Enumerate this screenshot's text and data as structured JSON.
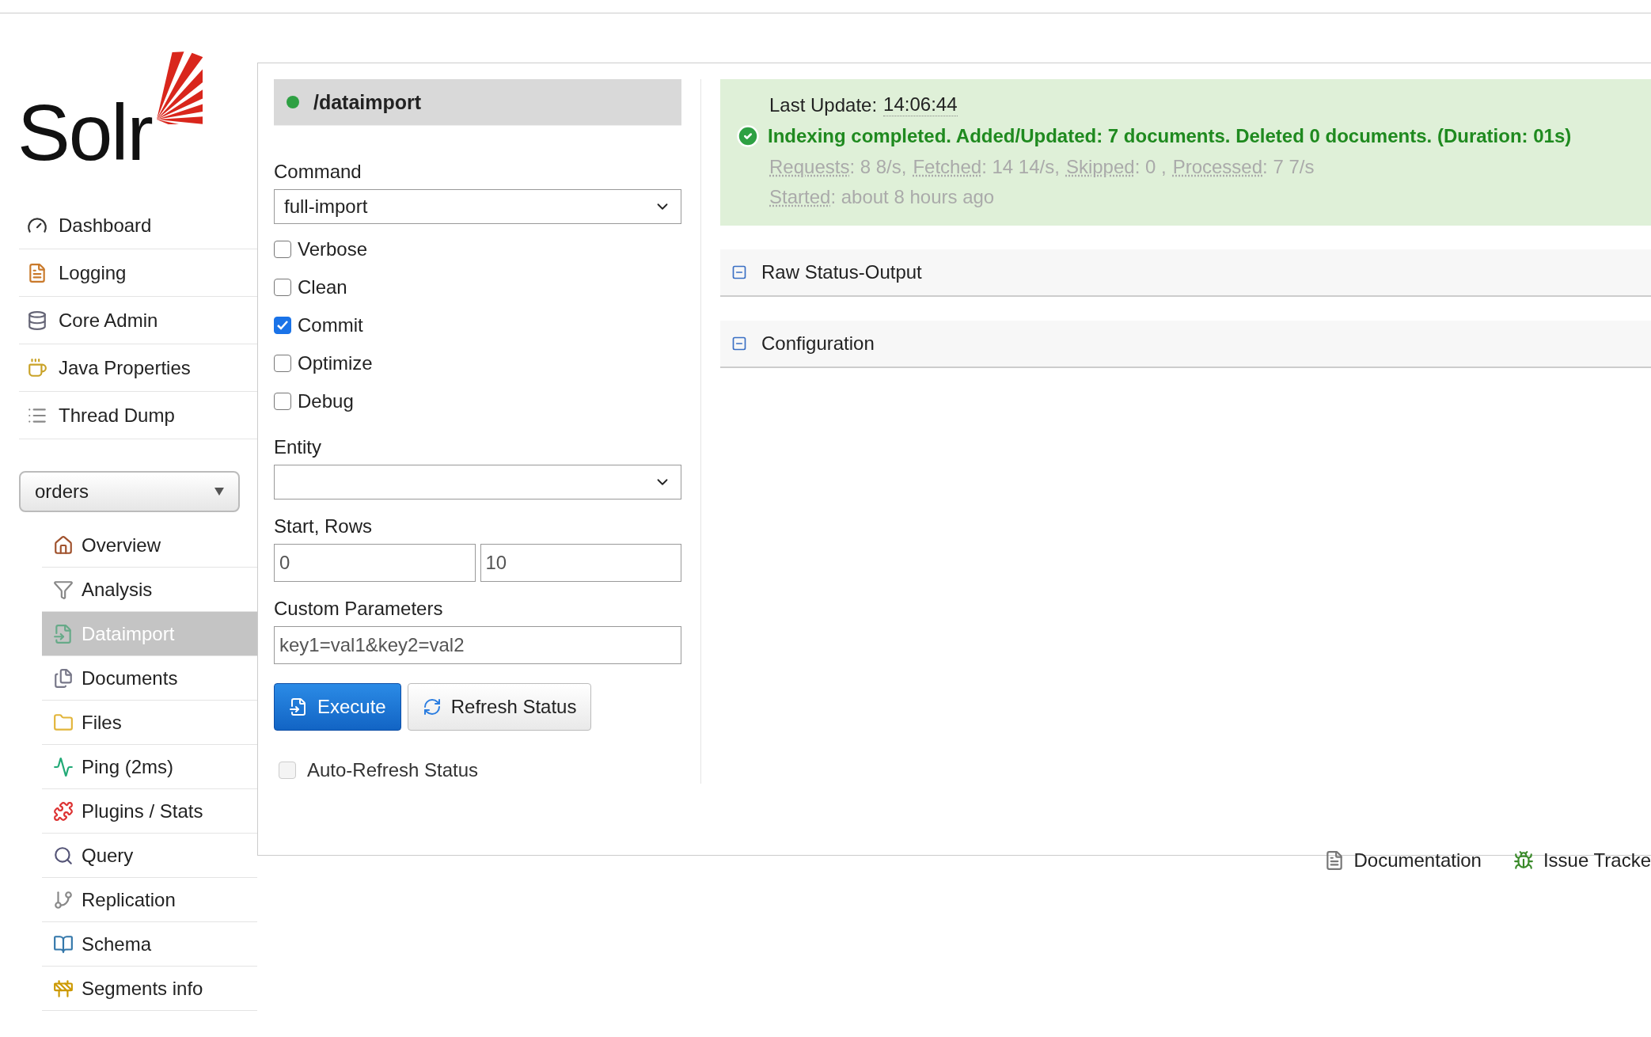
{
  "logo": {
    "text": "Solr"
  },
  "nav": [
    {
      "label": "Dashboard"
    },
    {
      "label": "Logging"
    },
    {
      "label": "Core Admin"
    },
    {
      "label": "Java Properties"
    },
    {
      "label": "Thread Dump"
    }
  ],
  "core_selector": {
    "value": "orders"
  },
  "core_menu": [
    {
      "label": "Overview",
      "selected": false
    },
    {
      "label": "Analysis",
      "selected": false
    },
    {
      "label": "Dataimport",
      "selected": true
    },
    {
      "label": "Documents",
      "selected": false
    },
    {
      "label": "Files",
      "selected": false
    },
    {
      "label": "Ping (2ms)",
      "selected": false
    },
    {
      "label": "Plugins / Stats",
      "selected": false
    },
    {
      "label": "Query",
      "selected": false
    },
    {
      "label": "Replication",
      "selected": false
    },
    {
      "label": "Schema",
      "selected": false
    },
    {
      "label": "Segments info",
      "selected": false
    }
  ],
  "handler": {
    "title": "/dataimport"
  },
  "form": {
    "command_label": "Command",
    "command_value": "full-import",
    "options": [
      {
        "label": "Verbose",
        "checked": false
      },
      {
        "label": "Clean",
        "checked": false
      },
      {
        "label": "Commit",
        "checked": true
      },
      {
        "label": "Optimize",
        "checked": false
      },
      {
        "label": "Debug",
        "checked": false
      }
    ],
    "entity_label": "Entity",
    "start_rows_label": "Start, Rows",
    "start_value": "0",
    "rows_value": "10",
    "custom_label": "Custom Parameters",
    "custom_value": "key1=val1&key2=val2",
    "buttons": [
      {
        "label": "Execute",
        "kind": "primary"
      },
      {
        "label": "Refresh Status",
        "kind": "secondary"
      }
    ],
    "auto_refresh": {
      "label": "Auto-Refresh Status",
      "checked": false
    }
  },
  "status": {
    "last_update_label": "Last Update:",
    "last_update_time": "14:06:44",
    "message": "Indexing completed. Added/Updated: 7 documents. Deleted 0 documents. (Duration: 01s)",
    "stats": [
      {
        "label": "Requests",
        "value": ": 8 8/s,"
      },
      {
        "label": "Fetched",
        "value": ": 14 14/s,"
      },
      {
        "label": "Skipped",
        "value": ": 0 ,"
      },
      {
        "label": "Processed",
        "value": ": 7 7/s"
      }
    ],
    "started": {
      "label": "Started",
      "value": ": about 8 hours ago"
    }
  },
  "sections": [
    {
      "title": "Raw Status-Output"
    },
    {
      "title": "Configuration"
    }
  ],
  "footer": [
    {
      "label": "Documentation"
    },
    {
      "label": "Issue Tracke"
    }
  ]
}
